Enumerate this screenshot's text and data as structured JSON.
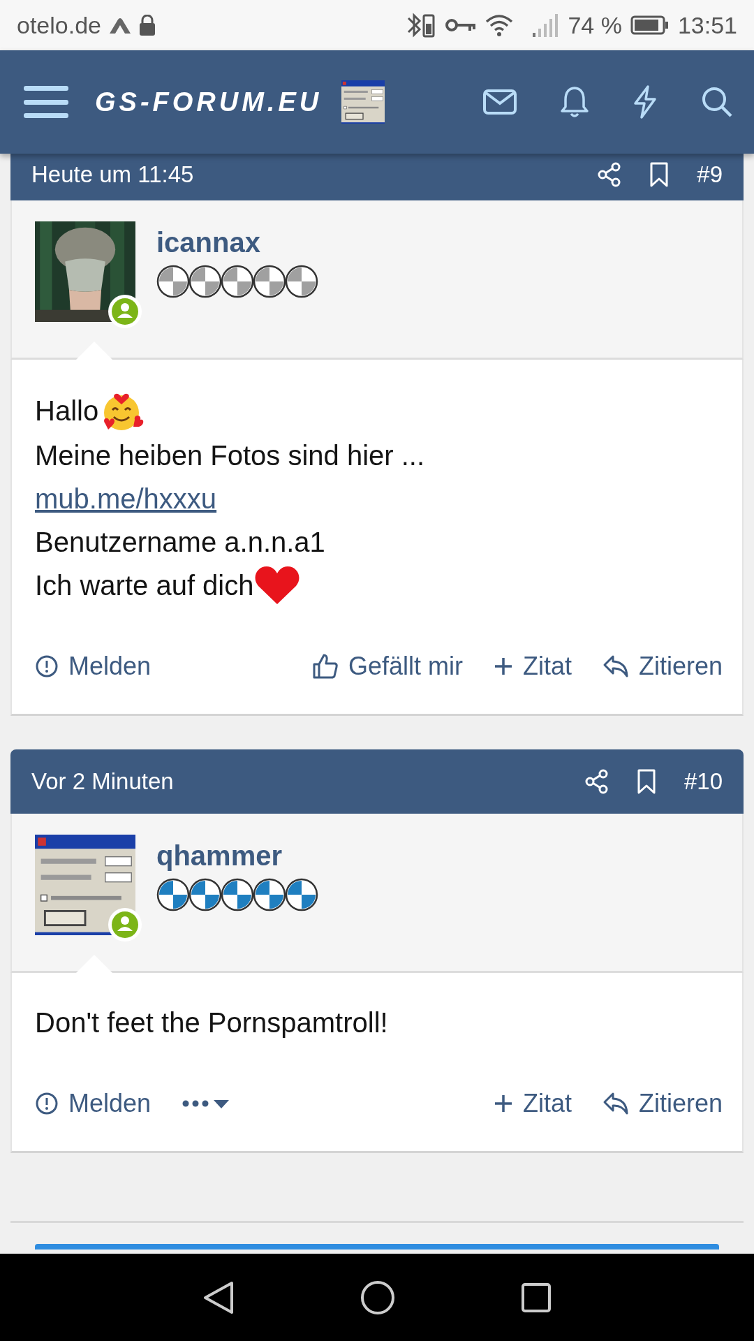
{
  "status_bar": {
    "carrier": "otelo.de",
    "battery": "74 %",
    "time": "13:51"
  },
  "header": {
    "logo": "GS-FORUM.EU",
    "thumbnail": {
      "kind": "picture"
    }
  },
  "posts": [
    {
      "time": "Heute um 11:45",
      "number": "#9",
      "author": "icannax",
      "online": true,
      "color": "#a0a0a0",
      "avatar": {
        "kind": "picture"
      },
      "lines": [
        {
          "kind": "text_face",
          "text": "Hallo"
        },
        {
          "kind": "text",
          "text": "Meine heiben Fotos sind hier ..."
        },
        {
          "kind": "link",
          "text": "mub.me/hxxxu"
        },
        {
          "kind": "text",
          "text": "Benutzername a.n.n.a1"
        },
        {
          "kind": "text_heart",
          "text": "Ich warte auf dich"
        }
      ],
      "actions": [
        {
          "kind": "report",
          "label": "Melden"
        },
        {
          "kind": "like",
          "label": "Gefällt mir"
        },
        {
          "kind": "multiquote",
          "label": "Zitat"
        },
        {
          "kind": "reply",
          "label": "Zitieren"
        }
      ]
    },
    {
      "time": "Vor 2 Minuten",
      "number": "#10",
      "author": "qhammer",
      "online": true,
      "color": "#1f7fc0",
      "avatar": {
        "kind": "picture"
      },
      "lines": [
        {
          "kind": "text",
          "text": "Don't feet the Pornspamtroll!"
        }
      ],
      "actions": [
        {
          "kind": "report",
          "label": "Melden"
        },
        {
          "kind": "more"
        },
        {
          "kind": "multiquote",
          "label": "Zitat"
        },
        {
          "kind": "reply",
          "label": "Zitieren"
        }
      ]
    }
  ]
}
